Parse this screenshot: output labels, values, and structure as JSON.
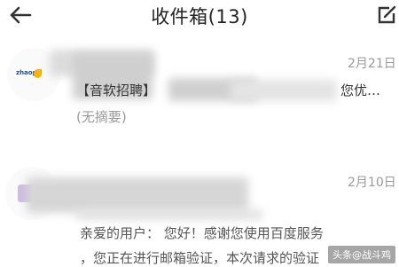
{
  "header": {
    "title": "收件箱(13)"
  },
  "emails": [
    {
      "date": "2月21日",
      "subject": "【音软招聘】",
      "subject_end": "您优…",
      "summary": "(无摘要)",
      "logo_text": "zhaop"
    },
    {
      "date": "2月10日",
      "line1": "亲爱的用户： 您好！感谢您使用百度服务",
      "line2": "，您正在进行邮箱验证，本次请求的验证"
    }
  ],
  "watermark": "头条@战斗鸡"
}
